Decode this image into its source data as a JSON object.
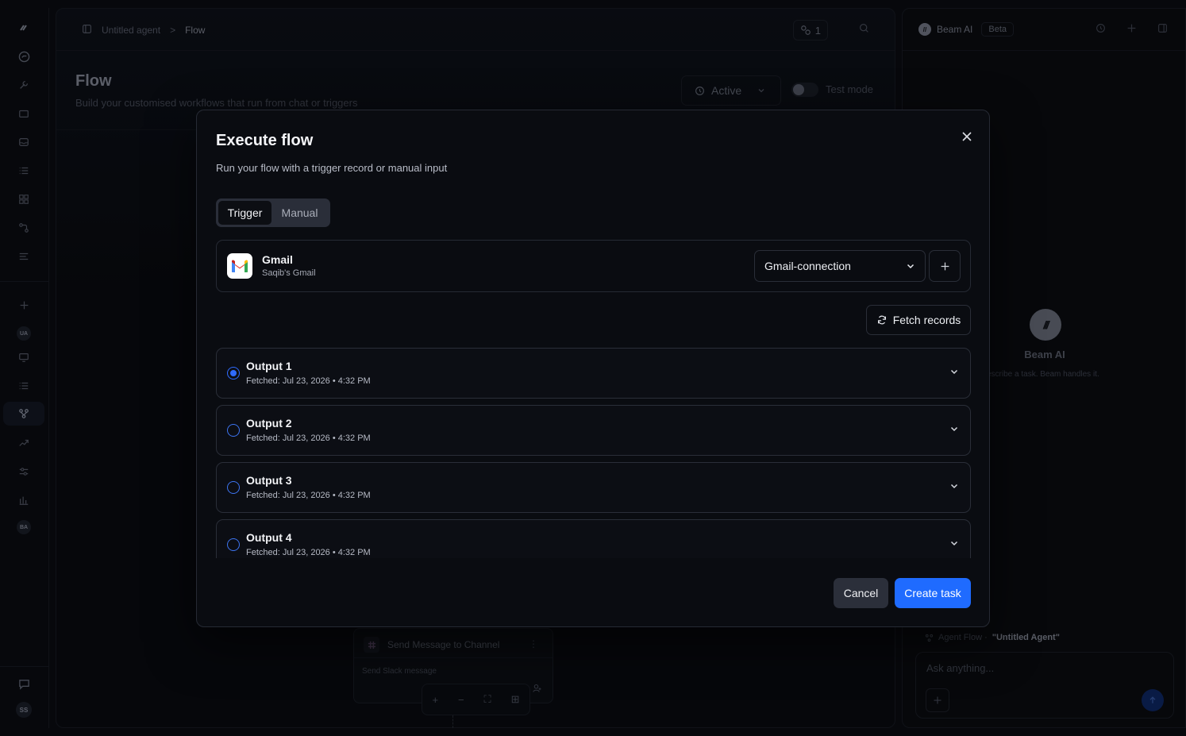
{
  "sidebar": {
    "icons": [
      "beam-logo-icon",
      "chat-bubble-icon",
      "wrench-icon",
      "folder-icon",
      "inbox-icon",
      "list-icon",
      "grid-icon",
      "git-icon",
      "lines-icon",
      "plus-icon",
      "monitor-icon",
      "list-icon",
      "flow-icon",
      "trend-icon",
      "sliders-icon",
      "chart-icon",
      "chat-icon"
    ],
    "badges": {
      "ua": "UA",
      "ba": "BA",
      "user": "SS"
    }
  },
  "header": {
    "breadcrumb": {
      "agent": "Untitled agent",
      "sep": ">",
      "current": "Flow"
    },
    "agent_count": "1"
  },
  "page": {
    "title": "Flow",
    "subtitle": "Build your customised workflows that run from chat or triggers",
    "status": "Active",
    "test_mode_label": "Test mode"
  },
  "flow_node": {
    "title": "Send Message to Channel",
    "subtitle": "Send Slack message"
  },
  "right_panel": {
    "title": "Beam AI",
    "beta": "Beta",
    "name": "Beam AI",
    "description": "escribe a task. Beam handles it.",
    "agent_flow_label": "Agent Flow · ",
    "agent_flow_name": "\"Untitled Agent\"",
    "ask_placeholder": "Ask anything..."
  },
  "modal": {
    "title": "Execute flow",
    "subtitle": "Run your flow with a trigger record or manual input",
    "tabs": {
      "trigger": "Trigger",
      "manual": "Manual"
    },
    "connection": {
      "app": "Gmail",
      "account": "Saqib's Gmail",
      "selected": "Gmail-connection"
    },
    "fetch_label": "Fetch records",
    "outputs": [
      {
        "name": "Output 1",
        "fetched": "Fetched: Jul 23, 2026 • 4:32 PM",
        "selected": true
      },
      {
        "name": "Output 2",
        "fetched": "Fetched: Jul 23, 2026 • 4:32 PM",
        "selected": false
      },
      {
        "name": "Output 3",
        "fetched": "Fetched: Jul 23, 2026 • 4:32 PM",
        "selected": false
      },
      {
        "name": "Output 4",
        "fetched": "Fetched: Jul 23, 2026 • 4:32 PM",
        "selected": false
      }
    ],
    "cancel_label": "Cancel",
    "create_label": "Create task"
  },
  "colors": {
    "accent": "#1f6bff",
    "background": "#0b0d13",
    "modal_bg": "#0a0c11"
  }
}
